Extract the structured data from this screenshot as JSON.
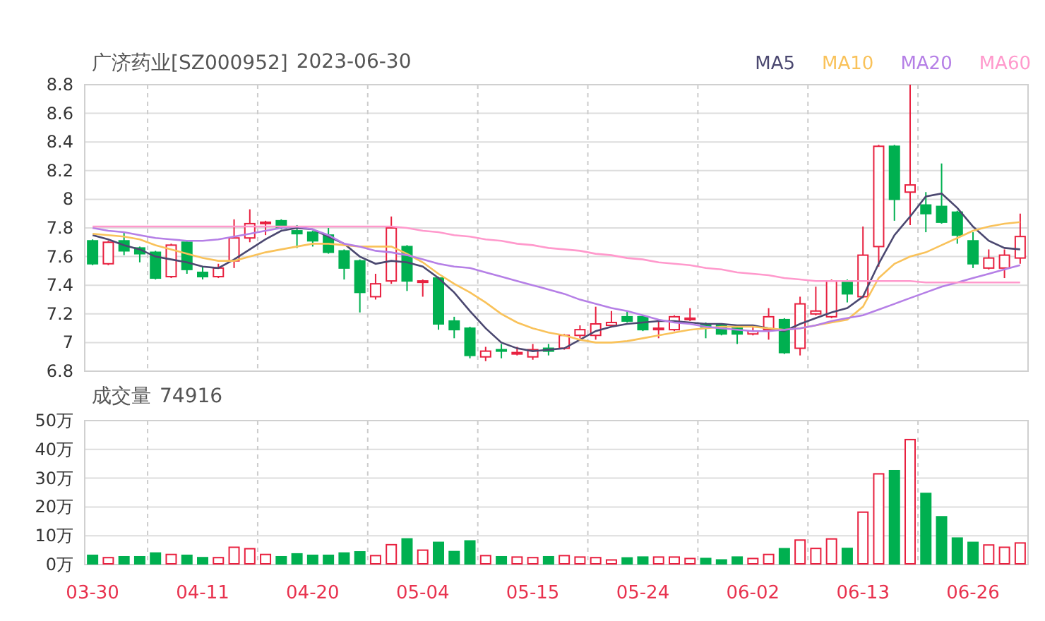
{
  "price": {
    "title": "广济药业[SZ000952]",
    "date": "2023-06-30",
    "chart_data": {
      "type": "candlestick",
      "grid": true,
      "ylim": [
        6.8,
        8.8
      ],
      "yticks": [
        6.8,
        7,
        7.2,
        7.4,
        7.6,
        7.8,
        8,
        8.2,
        8.4,
        8.6,
        8.8
      ],
      "categories": [
        null,
        null,
        null,
        null,
        null,
        null,
        null,
        null,
        null,
        null,
        null,
        null,
        null,
        null,
        null,
        null,
        null,
        null,
        null,
        null,
        null,
        null,
        null,
        null,
        null,
        null,
        null,
        null,
        null,
        null,
        null,
        null,
        null,
        null,
        null,
        null,
        null,
        null,
        null,
        null,
        null,
        null,
        null,
        null,
        null,
        null,
        null,
        null,
        null,
        null,
        null,
        null,
        null,
        null,
        null,
        null,
        null,
        null,
        null,
        null
      ],
      "ohlc": [
        [
          7.71,
          7.72,
          7.54,
          7.55
        ],
        [
          7.55,
          7.71,
          7.54,
          7.7
        ],
        [
          7.71,
          7.77,
          7.61,
          7.64
        ],
        [
          7.66,
          7.67,
          7.56,
          7.62
        ],
        [
          7.63,
          7.64,
          7.44,
          7.45
        ],
        [
          7.46,
          7.69,
          7.45,
          7.68
        ],
        [
          7.7,
          7.71,
          7.48,
          7.51
        ],
        [
          7.49,
          7.53,
          7.44,
          7.46
        ],
        [
          7.46,
          7.55,
          7.45,
          7.52
        ],
        [
          7.57,
          7.86,
          7.52,
          7.73
        ],
        [
          7.73,
          7.93,
          7.7,
          7.83
        ],
        [
          7.84,
          7.85,
          7.75,
          7.84
        ],
        [
          7.85,
          7.86,
          7.79,
          7.8
        ],
        [
          7.78,
          7.82,
          7.66,
          7.76
        ],
        [
          7.77,
          7.78,
          7.67,
          7.71
        ],
        [
          7.75,
          7.8,
          7.62,
          7.63
        ],
        [
          7.64,
          7.65,
          7.44,
          7.52
        ],
        [
          7.57,
          7.58,
          7.21,
          7.35
        ],
        [
          7.32,
          7.48,
          7.3,
          7.41
        ],
        [
          7.43,
          7.88,
          7.41,
          7.8
        ],
        [
          7.67,
          7.68,
          7.36,
          7.43
        ],
        [
          7.42,
          7.44,
          7.32,
          7.43
        ],
        [
          7.45,
          7.46,
          7.09,
          7.13
        ],
        [
          7.15,
          7.18,
          7.03,
          7.09
        ],
        [
          7.1,
          7.11,
          6.89,
          6.91
        ],
        [
          6.9,
          6.97,
          6.87,
          6.94
        ],
        [
          6.95,
          6.99,
          6.89,
          6.94
        ],
        [
          6.92,
          6.97,
          6.91,
          6.93
        ],
        [
          6.9,
          6.99,
          6.88,
          6.95
        ],
        [
          6.96,
          6.99,
          6.91,
          6.94
        ],
        [
          6.96,
          7.06,
          6.95,
          7.05
        ],
        [
          7.05,
          7.12,
          7.03,
          7.09
        ],
        [
          7.05,
          7.25,
          7.02,
          7.13
        ],
        [
          7.12,
          7.22,
          7.11,
          7.14
        ],
        [
          7.18,
          7.22,
          7.14,
          7.15
        ],
        [
          7.18,
          7.19,
          7.08,
          7.09
        ],
        [
          7.09,
          7.16,
          7.03,
          7.1
        ],
        [
          7.09,
          7.19,
          7.08,
          7.18
        ],
        [
          7.16,
          7.24,
          7.15,
          7.17
        ],
        [
          7.13,
          7.14,
          7.03,
          7.11
        ],
        [
          7.12,
          7.13,
          7.05,
          7.06
        ],
        [
          7.1,
          7.11,
          6.99,
          7.06
        ],
        [
          7.06,
          7.12,
          7.05,
          7.08
        ],
        [
          7.09,
          7.24,
          7.02,
          7.18
        ],
        [
          7.16,
          7.17,
          6.92,
          6.93
        ],
        [
          6.96,
          7.32,
          6.91,
          7.27
        ],
        [
          7.2,
          7.39,
          7.19,
          7.22
        ],
        [
          7.18,
          7.44,
          7.17,
          7.43
        ],
        [
          7.43,
          7.44,
          7.28,
          7.34
        ],
        [
          7.32,
          7.81,
          7.31,
          7.61
        ],
        [
          7.67,
          8.38,
          7.53,
          8.37
        ],
        [
          8.37,
          8.38,
          7.85,
          8.0
        ],
        [
          8.05,
          8.8,
          7.82,
          8.1
        ],
        [
          7.96,
          8.05,
          7.77,
          7.9
        ],
        [
          7.95,
          8.25,
          7.83,
          7.84
        ],
        [
          7.91,
          7.92,
          7.69,
          7.75
        ],
        [
          7.71,
          7.77,
          7.52,
          7.55
        ],
        [
          7.52,
          7.65,
          7.51,
          7.59
        ],
        [
          7.52,
          7.65,
          7.45,
          7.61
        ],
        [
          7.59,
          7.9,
          7.55,
          7.74
        ]
      ],
      "series": [
        {
          "name": "MA5",
          "type": "line",
          "color": "#4b4870",
          "values": [
            7.75,
            7.72,
            7.68,
            7.65,
            7.6,
            7.58,
            7.56,
            7.53,
            7.52,
            7.58,
            7.65,
            7.72,
            7.78,
            7.8,
            7.79,
            7.74,
            7.69,
            7.6,
            7.55,
            7.57,
            7.56,
            7.53,
            7.45,
            7.35,
            7.22,
            7.1,
            7.0,
            6.96,
            6.94,
            6.95,
            6.96,
            7.02,
            7.08,
            7.11,
            7.13,
            7.14,
            7.15,
            7.15,
            7.14,
            7.13,
            7.13,
            7.12,
            7.12,
            7.1,
            7.08,
            7.13,
            7.17,
            7.21,
            7.24,
            7.32,
            7.55,
            7.75,
            7.88,
            8.02,
            8.04,
            7.94,
            7.81,
            7.71,
            7.66,
            7.65
          ]
        },
        {
          "name": "MA10",
          "type": "line",
          "color": "#f9c25a",
          "values": [
            7.76,
            7.75,
            7.74,
            7.72,
            7.68,
            7.65,
            7.62,
            7.59,
            7.57,
            7.57,
            7.6,
            7.63,
            7.65,
            7.67,
            7.69,
            7.69,
            7.68,
            7.67,
            7.67,
            7.67,
            7.62,
            7.56,
            7.48,
            7.41,
            7.35,
            7.28,
            7.2,
            7.14,
            7.1,
            7.07,
            7.05,
            7.02,
            7.0,
            7.0,
            7.01,
            7.03,
            7.05,
            7.07,
            7.09,
            7.1,
            7.11,
            7.11,
            7.11,
            7.1,
            7.09,
            7.1,
            7.12,
            7.14,
            7.16,
            7.25,
            7.45,
            7.55,
            7.6,
            7.63,
            7.68,
            7.73,
            7.78,
            7.81,
            7.83,
            7.84
          ]
        },
        {
          "name": "MA20",
          "type": "line",
          "color": "#b57fe6",
          "values": [
            7.8,
            7.78,
            7.77,
            7.75,
            7.73,
            7.72,
            7.71,
            7.71,
            7.72,
            7.74,
            7.76,
            7.78,
            7.8,
            7.81,
            7.79,
            7.75,
            7.69,
            7.67,
            7.64,
            7.63,
            7.61,
            7.58,
            7.55,
            7.53,
            7.52,
            7.49,
            7.46,
            7.43,
            7.4,
            7.37,
            7.34,
            7.3,
            7.27,
            7.24,
            7.22,
            7.19,
            7.16,
            7.14,
            7.13,
            7.11,
            7.1,
            7.09,
            7.08,
            7.08,
            7.09,
            7.1,
            7.12,
            7.15,
            7.17,
            7.19,
            7.23,
            7.27,
            7.31,
            7.35,
            7.39,
            7.42,
            7.45,
            7.48,
            7.51,
            7.54
          ]
        },
        {
          "name": "MA60",
          "type": "line",
          "color": "#ff99cc",
          "values": [
            7.81,
            7.81,
            7.81,
            7.81,
            7.81,
            7.81,
            7.81,
            7.81,
            7.81,
            7.81,
            7.81,
            7.81,
            7.81,
            7.81,
            7.81,
            7.81,
            7.81,
            7.81,
            7.81,
            7.81,
            7.8,
            7.78,
            7.77,
            7.75,
            7.74,
            7.72,
            7.71,
            7.69,
            7.68,
            7.66,
            7.65,
            7.64,
            7.62,
            7.61,
            7.59,
            7.58,
            7.56,
            7.55,
            7.54,
            7.52,
            7.51,
            7.49,
            7.48,
            7.47,
            7.45,
            7.44,
            7.43,
            7.43,
            7.43,
            7.43,
            7.43,
            7.43,
            7.43,
            7.42,
            7.42,
            7.42,
            7.42,
            7.42,
            7.42,
            7.42
          ]
        }
      ]
    }
  },
  "volume": {
    "label": "成交量",
    "value": "74916",
    "chart_data": {
      "type": "bar",
      "grid": true,
      "ylim": [
        0,
        50
      ],
      "yticks": [
        {
          "value": 0,
          "label": "0万"
        },
        {
          "value": 10,
          "label": "10万"
        },
        {
          "value": 20,
          "label": "20万"
        },
        {
          "value": 30,
          "label": "30万"
        },
        {
          "value": 40,
          "label": "40万"
        },
        {
          "value": 50,
          "label": "50万"
        }
      ],
      "categories": [
        "03-30",
        null,
        null,
        null,
        null,
        null,
        null,
        "04-11",
        null,
        null,
        null,
        null,
        null,
        null,
        "04-20",
        null,
        null,
        null,
        null,
        null,
        null,
        "05-04",
        null,
        null,
        null,
        null,
        null,
        null,
        "05-15",
        null,
        null,
        null,
        null,
        null,
        null,
        "05-24",
        null,
        null,
        null,
        null,
        null,
        null,
        "06-02",
        null,
        null,
        null,
        null,
        null,
        null,
        "06-13",
        null,
        null,
        null,
        null,
        null,
        null,
        "06-26",
        null,
        null,
        null
      ],
      "values": [
        3.2,
        2.4,
        2.7,
        2.7,
        4.0,
        3.5,
        3.2,
        2.4,
        2.4,
        6.0,
        5.5,
        3.5,
        2.7,
        3.7,
        3.2,
        3.2,
        4.0,
        4.4,
        3.1,
        6.9,
        8.9,
        5.0,
        7.7,
        4.5,
        8.2,
        3.1,
        2.7,
        2.6,
        2.4,
        2.7,
        3.1,
        2.6,
        2.4,
        1.6,
        2.3,
        2.6,
        2.6,
        2.6,
        2.1,
        2.1,
        1.6,
        2.6,
        2.1,
        3.5,
        5.5,
        8.5,
        5.6,
        8.9,
        5.6,
        18.2,
        31.5,
        32.6,
        43.4,
        24.7,
        16.6,
        9.2,
        7.7,
        6.8,
        6.0,
        7.5
      ]
    }
  }
}
